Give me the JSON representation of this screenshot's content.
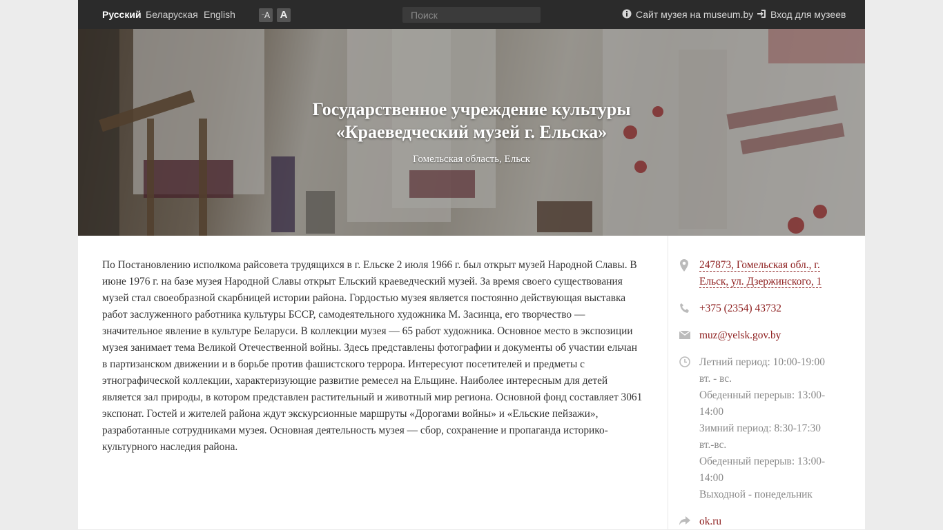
{
  "topbar": {
    "languages": [
      {
        "label": "Русский",
        "active": true
      },
      {
        "label": "Беларуская",
        "active": false
      },
      {
        "label": "English",
        "active": false
      }
    ],
    "font_small_label": "A",
    "font_large_label": "A",
    "search_placeholder": "Поиск",
    "museum_site_link": "Сайт музея на museum.by",
    "login_link": "Вход для музеев"
  },
  "hero": {
    "title_line1": "Государственное учреждение культуры",
    "title_line2": "«Краеведческий музей г. Ельска»",
    "subtitle": "Гомельская область, Ельск"
  },
  "main": {
    "description": "По Постановлению исполкома райсовета трудящихся в г. Ельске 2 июля 1966 г. был открыт музей Народной Славы. В июне 1976 г. на базе музея Народной Славы открыт Ельский краеведческий музей. За время своего существования музей стал своеобразной скарбницей истории района. Гордостью музея является постоянно действующая выставка работ заслуженного работника культуры БССР, самодеятельного художника М. Засинца, его творчество — значительное явление в культуре Беларуси. В коллекции музея — 65 работ художника. Основное место в экспозиции музея занимает тема Великой Отечественной войны. Здесь представлены фотографии и документы об участии ельчан в партизанском движении и в борьбе против фашистского террора. Интересуют посетителей и предметы с этнографической коллекции, характеризующие развитие ремесел на Ельщине. Наиболее интересным для детей является зал природы, в котором представлен растительный и животный мир региона. Основной фонд составляет 3061 экспонат. Гостей и жителей района ждут экскурсионные маршруты «Дорогами войны» и «Ельские пейзажи», разработанные сотрудниками музея. Основная деятельность музея — сбор, сохранение и пропаганда историко-культурного наследия района."
  },
  "sidebar": {
    "address_line1": "247873, Гомельская обл., г.",
    "address_line2": "Ельск, ул. Дзержинского, 1",
    "phone": "+375 (2354) 43732",
    "email": "muz@yelsk.gov.by",
    "hours": [
      "Летний период: 10:00-19:00",
      "вт. - вс.",
      "Обеденный перерыв: 13:00-",
      "14:00",
      "Зимний период: 8:30-17:30",
      "вт.-вс.",
      "Обеденный перерыв: 13:00-",
      "14:00",
      "Выходной - понедельник"
    ],
    "social_link": "ok.ru"
  },
  "colors": {
    "topbar_bg": "#2b2b2b",
    "link": "#8b1a1a",
    "muted": "#888888",
    "icon": "#bbbbbb"
  },
  "icons": {
    "museum_site": "info-circle-icon",
    "login": "sign-in-icon",
    "address": "map-marker-icon",
    "phone": "phone-icon",
    "email": "envelope-icon",
    "hours": "clock-icon",
    "social": "share-arrow-icon"
  }
}
